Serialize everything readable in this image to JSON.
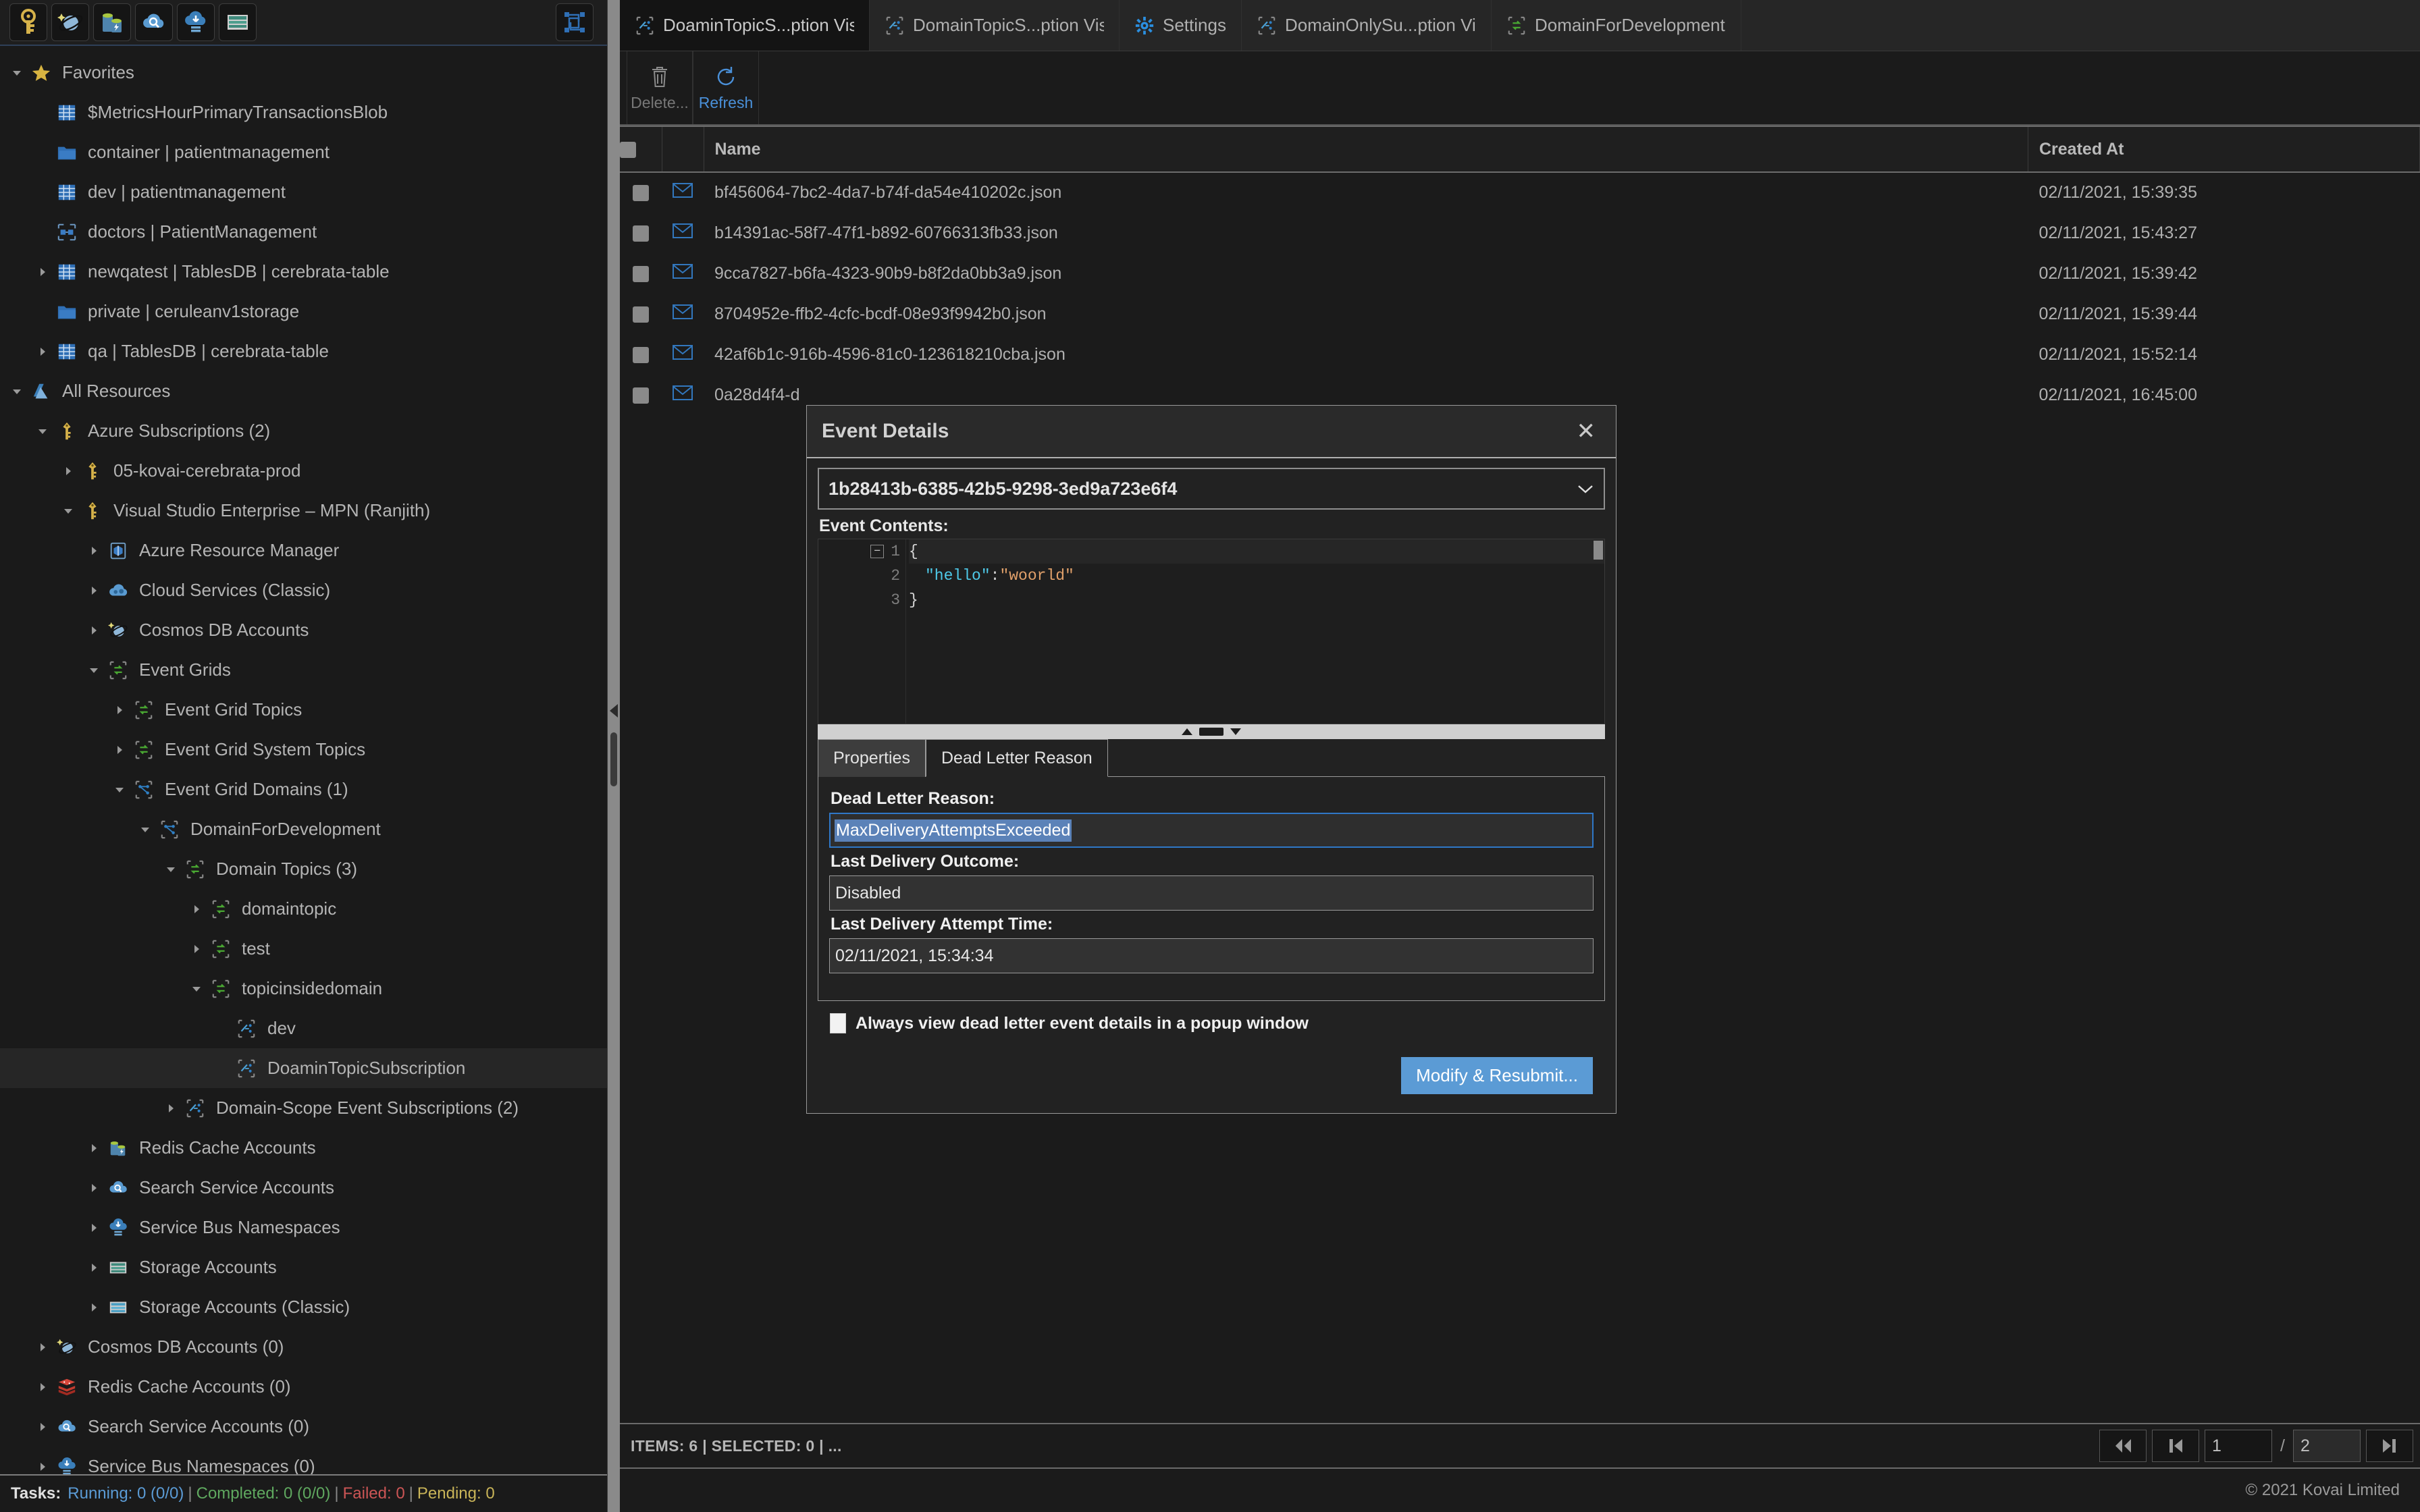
{
  "left_toolbar": {
    "buttons": [
      {
        "name": "azure-key-icon",
        "title": "Azure Subscriptions"
      },
      {
        "name": "cosmos-db-icon",
        "title": "Cosmos DB Accounts"
      },
      {
        "name": "redis-cache-icon",
        "title": "Redis Cache Accounts"
      },
      {
        "name": "search-service-icon",
        "title": "Search Service Accounts"
      },
      {
        "name": "service-bus-icon",
        "title": "Service Bus Namespaces"
      },
      {
        "name": "storage-account-icon",
        "title": "Storage Accounts"
      }
    ],
    "right_button": {
      "name": "layout-icon",
      "title": "Arrange"
    }
  },
  "tree": [
    {
      "label": "Favorites",
      "depth": 0,
      "twisty": "down",
      "icon": "star-icon"
    },
    {
      "label": "$MetricsHourPrimaryTransactionsBlob",
      "depth": 1,
      "twisty": "none",
      "icon": "table-icon"
    },
    {
      "label": "container | patientmanagement",
      "depth": 1,
      "twisty": "none",
      "icon": "folder-icon"
    },
    {
      "label": "dev | patientmanagement",
      "depth": 1,
      "twisty": "none",
      "icon": "table-icon"
    },
    {
      "label": "doctors | PatientManagement",
      "depth": 1,
      "twisty": "none",
      "icon": "cosmos-container-icon"
    },
    {
      "label": "newqatest | TablesDB | cerebrata-table",
      "depth": 1,
      "twisty": "right",
      "icon": "table-icon"
    },
    {
      "label": "private | ceruleanv1storage",
      "depth": 1,
      "twisty": "none",
      "icon": "folder-icon"
    },
    {
      "label": "qa | TablesDB | cerebrata-table",
      "depth": 1,
      "twisty": "right",
      "icon": "table-icon"
    },
    {
      "label": "All Resources",
      "depth": 0,
      "twisty": "down",
      "icon": "azure-icon"
    },
    {
      "label": "Azure Subscriptions (2)",
      "depth": 1,
      "twisty": "down",
      "icon": "key-icon"
    },
    {
      "label": "05-kovai-cerebrata-prod",
      "depth": 2,
      "twisty": "right",
      "icon": "key-icon"
    },
    {
      "label": "Visual Studio Enterprise – MPN (Ranjith)",
      "depth": 2,
      "twisty": "down",
      "icon": "key-icon"
    },
    {
      "label": "Azure Resource Manager",
      "depth": 3,
      "twisty": "right",
      "icon": "arm-icon"
    },
    {
      "label": "Cloud Services (Classic)",
      "depth": 3,
      "twisty": "right",
      "icon": "cloud-services-icon"
    },
    {
      "label": "Cosmos DB Accounts",
      "depth": 3,
      "twisty": "right",
      "icon": "cosmos-db-icon"
    },
    {
      "label": "Event Grids",
      "depth": 3,
      "twisty": "down",
      "icon": "event-grid-icon"
    },
    {
      "label": "Event Grid Topics",
      "depth": 4,
      "twisty": "right",
      "icon": "event-grid-topic-icon"
    },
    {
      "label": "Event Grid System Topics",
      "depth": 4,
      "twisty": "right",
      "icon": "event-grid-topic-icon"
    },
    {
      "label": "Event Grid Domains (1)",
      "depth": 4,
      "twisty": "down",
      "icon": "event-grid-domain-icon"
    },
    {
      "label": "DomainForDevelopment",
      "depth": 5,
      "twisty": "down",
      "icon": "event-grid-domain-icon"
    },
    {
      "label": "Domain Topics (3)",
      "depth": 6,
      "twisty": "down",
      "icon": "event-grid-topic-icon"
    },
    {
      "label": "domaintopic",
      "depth": 7,
      "twisty": "right",
      "icon": "event-grid-topic-icon"
    },
    {
      "label": "test",
      "depth": 7,
      "twisty": "right",
      "icon": "event-grid-topic-icon"
    },
    {
      "label": "topicinsidedomain",
      "depth": 7,
      "twisty": "down",
      "icon": "event-grid-topic-icon"
    },
    {
      "label": "dev",
      "depth": 8,
      "twisty": "none",
      "icon": "event-subscription-icon"
    },
    {
      "label": "DoaminTopicSubscription",
      "depth": 8,
      "twisty": "none",
      "icon": "event-subscription-icon",
      "selected": true
    },
    {
      "label": "Domain-Scope Event Subscriptions (2)",
      "depth": 6,
      "twisty": "right",
      "icon": "event-subscription-icon"
    },
    {
      "label": "Redis Cache Accounts",
      "depth": 3,
      "twisty": "right",
      "icon": "redis-cache-icon"
    },
    {
      "label": "Search Service Accounts",
      "depth": 3,
      "twisty": "right",
      "icon": "search-service-icon"
    },
    {
      "label": "Service Bus Namespaces",
      "depth": 3,
      "twisty": "right",
      "icon": "service-bus-icon"
    },
    {
      "label": "Storage Accounts",
      "depth": 3,
      "twisty": "right",
      "icon": "storage-account-icon"
    },
    {
      "label": "Storage Accounts (Classic)",
      "depth": 3,
      "twisty": "right",
      "icon": "storage-classic-icon"
    },
    {
      "label": "Cosmos DB Accounts (0)",
      "depth": 1,
      "twisty": "right",
      "icon": "cosmos-db-icon"
    },
    {
      "label": "Redis Cache Accounts (0)",
      "depth": 1,
      "twisty": "right",
      "icon": "redis-logo-icon"
    },
    {
      "label": "Search Service Accounts (0)",
      "depth": 1,
      "twisty": "right",
      "icon": "search-service-icon"
    },
    {
      "label": "Service Bus Namespaces (0)",
      "depth": 1,
      "twisty": "right",
      "icon": "service-bus-icon"
    }
  ],
  "task_bar": {
    "label": "Tasks:",
    "running": "Running: 0 (0/0)",
    "completed": "Completed: 0 (0/0)",
    "failed": "Failed: 0",
    "pending": "Pending: 0",
    "separator": "|"
  },
  "tabs": [
    {
      "label": "DoaminTopicS...ption Visual",
      "icon": "event-subscription-icon",
      "active": true
    },
    {
      "label": "DomainTopicS...ption Visual",
      "icon": "event-subscription-icon",
      "active": false
    },
    {
      "label": "Settings",
      "icon": "gear-icon",
      "active": false
    },
    {
      "label": "DomainOnlySu...ption Visu",
      "icon": "event-subscription-icon",
      "active": false
    },
    {
      "label": "DomainForDevelopment Vi",
      "icon": "event-grid-topic-icon",
      "active": false
    }
  ],
  "content_toolbar": {
    "delete_label": "Delete...",
    "refresh_label": "Refresh"
  },
  "table": {
    "headers": [
      "",
      "",
      "Name",
      "Created At"
    ],
    "rows": [
      {
        "name": "bf456064-7bc2-4da7-b74f-da54e410202c.json",
        "created_at": "02/11/2021, 15:39:35"
      },
      {
        "name": "b14391ac-58f7-47f1-b892-60766313fb33.json",
        "created_at": "02/11/2021, 15:43:27"
      },
      {
        "name": "9cca7827-b6fa-4323-90b9-b8f2da0bb3a9.json",
        "created_at": "02/11/2021, 15:39:42"
      },
      {
        "name": "8704952e-ffb2-4cfc-bcdf-08e93f9942b0.json",
        "created_at": "02/11/2021, 15:39:44"
      },
      {
        "name": "42af6b1c-916b-4596-81c0-123618210cba.json",
        "created_at": "02/11/2021, 15:52:14"
      },
      {
        "name": "0a28d4f4-d",
        "created_at": "02/11/2021, 16:45:00"
      }
    ]
  },
  "status_strip": {
    "text": "ITEMS: 6 | SELECTED: 0 |  ...",
    "pager": {
      "first_label": "first-page",
      "prev_label": "previous-page",
      "current_page": "1",
      "separator": "/",
      "total_pages": "2",
      "last_label": "last-page"
    }
  },
  "footer": {
    "copyright": "© 2021 Kovai Limited"
  },
  "modal": {
    "title": "Event Details",
    "close_label": "✕",
    "event_id": "1b28413b-6385-42b5-9298-3ed9a723e6f4",
    "contents_label": "Event Contents:",
    "code": [
      {
        "num": "1",
        "fold": "−",
        "text": "{"
      },
      {
        "num": "2",
        "fold": "",
        "key": "\"hello\"",
        "colon": ": ",
        "value": "\"woorld\""
      },
      {
        "num": "3",
        "fold": "",
        "text": "}"
      }
    ],
    "tabs": [
      {
        "label": "Properties",
        "active": false
      },
      {
        "label": "Dead Letter Reason",
        "active": true
      }
    ],
    "fields": {
      "dead_letter_reason_label": "Dead Letter Reason:",
      "dead_letter_reason_value": "MaxDeliveryAttemptsExceeded",
      "last_delivery_outcome_label": "Last Delivery Outcome:",
      "last_delivery_outcome_value": "Disabled",
      "last_delivery_attempt_label": "Last Delivery Attempt Time:",
      "last_delivery_attempt_value": "02/11/2021, 15:34:34"
    },
    "checkbox_label": "Always view dead letter event details in a popup window",
    "primary_button": "Modify & Resubmit..."
  },
  "colors": {
    "accent_blue": "#5b9bd5",
    "selection_blue": "#5b82b8",
    "focus_border": "#2f77c7",
    "window_bg": "#1b1b1b"
  }
}
